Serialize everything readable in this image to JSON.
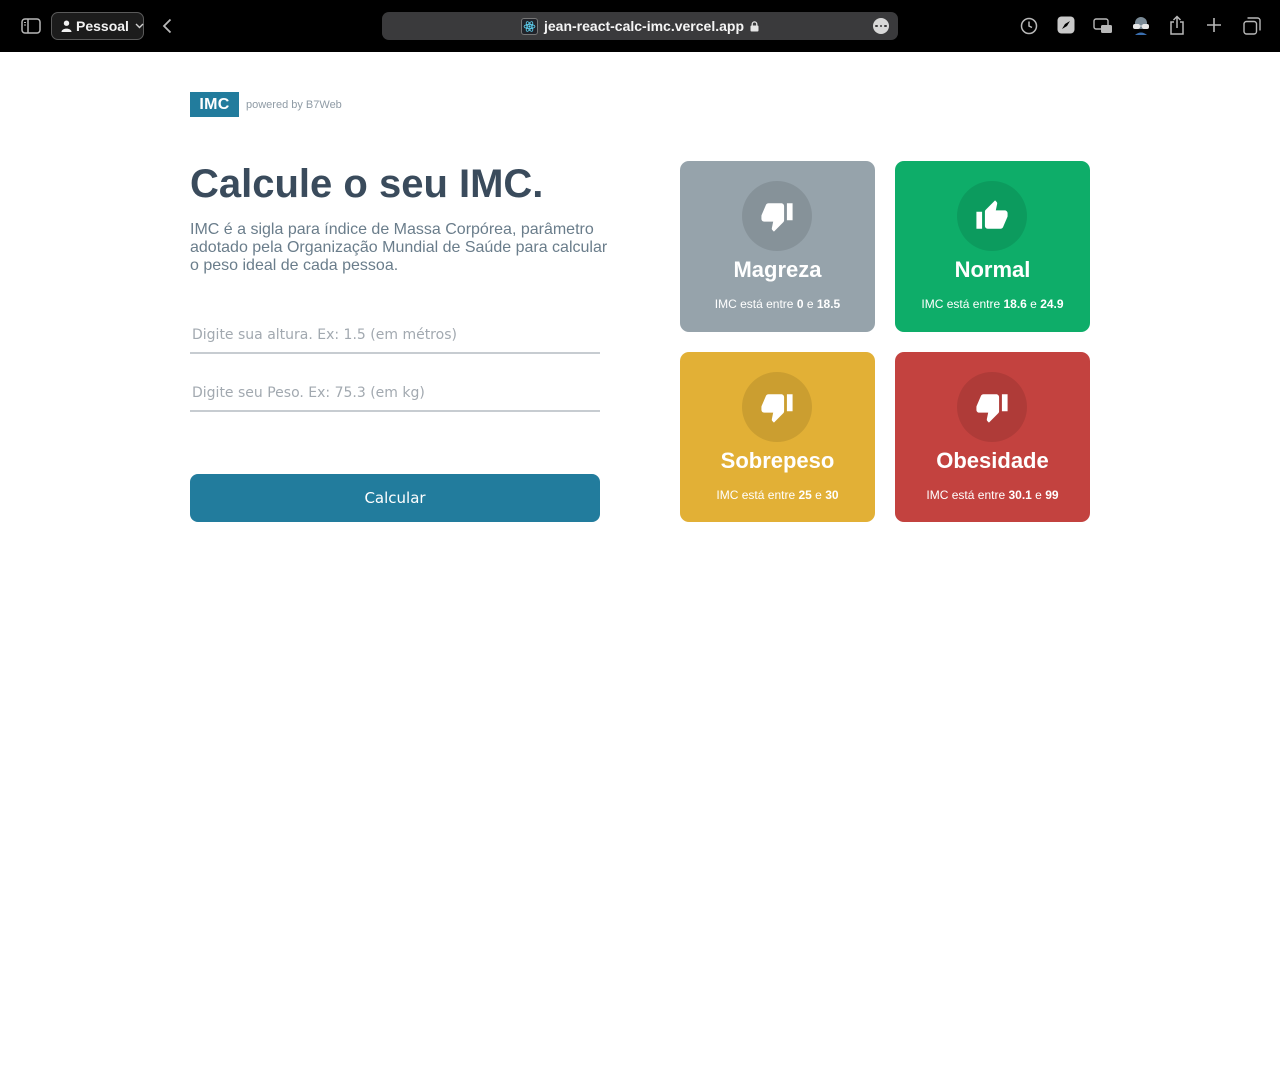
{
  "browser": {
    "profile_label": "Pessoal",
    "address": "jean-react-calc-imc.vercel.app"
  },
  "header": {
    "logo_text": "IMC",
    "powered_by": "powered by B7Web"
  },
  "main": {
    "title": "Calcule o seu IMC.",
    "description": "IMC é a sigla para índice de Massa Corpórea, parâmetro adotado pela Organização Mundial de Saúde para calcular o peso ideal de cada pessoa.",
    "height_placeholder": "Digite sua altura. Ex: 1.5 (em métros)",
    "height_value": "",
    "weight_placeholder": "Digite seu Peso. Ex: 75.3 (em kg)",
    "weight_value": "",
    "calc_button": "Calcular"
  },
  "levels": [
    {
      "title": "Magreza",
      "range_prefix": "IMC está entre",
      "min": "0",
      "joiner": "e",
      "max": "18.5",
      "color": "#96a3ab",
      "icon": "thumbs-down-icon"
    },
    {
      "title": "Normal",
      "range_prefix": "IMC está entre",
      "min": "18.6",
      "joiner": "e",
      "max": "24.9",
      "color": "#0ead69",
      "icon": "thumbs-up-icon"
    },
    {
      "title": "Sobrepeso",
      "range_prefix": "IMC está entre",
      "min": "25",
      "joiner": "e",
      "max": "30",
      "color": "#e2b036",
      "icon": "thumbs-down-icon"
    },
    {
      "title": "Obesidade",
      "range_prefix": "IMC está entre",
      "min": "30.1",
      "joiner": "e",
      "max": "99",
      "color": "#c3423f",
      "icon": "thumbs-down-icon"
    }
  ]
}
